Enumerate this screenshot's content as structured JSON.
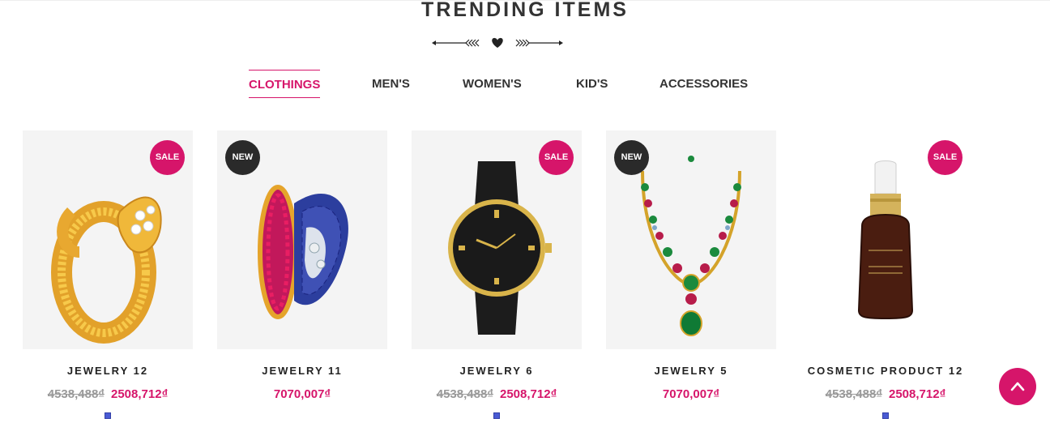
{
  "section": {
    "title": "TRENDING ITEMS"
  },
  "tabs": [
    {
      "label": "CLOTHINGS",
      "active": true
    },
    {
      "label": "MEN'S",
      "active": false
    },
    {
      "label": "WOMEN'S",
      "active": false
    },
    {
      "label": "KID'S",
      "active": false
    },
    {
      "label": "ACCESSORIES",
      "active": false
    }
  ],
  "products": [
    {
      "name": "JEWELRY 12",
      "badge": "SALE",
      "old_price": "4538,488₫",
      "price": "2508,712₫",
      "has_swatch": true,
      "image": "gold-ring"
    },
    {
      "name": "JEWELRY 11",
      "badge": "NEW",
      "old_price": "",
      "price": "7070,007₫",
      "has_swatch": false,
      "image": "gem-bracelet"
    },
    {
      "name": "JEWELRY 6",
      "badge": "SALE",
      "old_price": "4538,488₫",
      "price": "2508,712₫",
      "has_swatch": true,
      "image": "black-watch"
    },
    {
      "name": "JEWELRY 5",
      "badge": "NEW",
      "old_price": "",
      "price": "7070,007₫",
      "has_swatch": false,
      "image": "gem-necklace"
    },
    {
      "name": "COSMETIC PRODUCT 12",
      "badge": "SALE",
      "old_price": "4538,488₫",
      "price": "2508,712₫",
      "has_swatch": true,
      "image": "serum-bottle"
    }
  ],
  "colors": {
    "accent": "#d6156a",
    "badge_new": "#2a2a2a",
    "swatch": "#4a5bd4"
  },
  "back_to_top": {
    "icon": "chevron-up-icon"
  }
}
